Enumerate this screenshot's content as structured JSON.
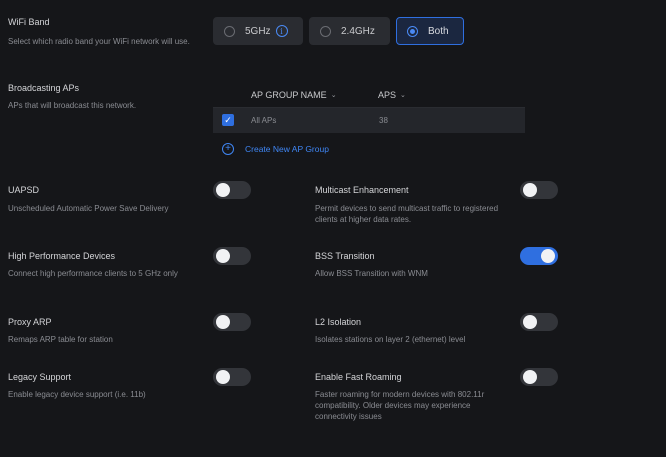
{
  "wifi_band": {
    "label": "WiFi Band",
    "desc": "Select which radio band your WiFi network will use.",
    "options": [
      "5GHz",
      "2.4GHz",
      "Both"
    ],
    "selected": "Both"
  },
  "broadcasting": {
    "label": "Broadcasting APs",
    "desc": "APs that will broadcast this network.",
    "col_group": "AP GROUP NAME",
    "col_aps": "APS",
    "rows": [
      {
        "name": "All APs",
        "aps": "38"
      }
    ],
    "create_label": "Create New AP Group"
  },
  "settings": {
    "uapsd": {
      "label": "UAPSD",
      "desc": "Unscheduled Automatic Power Save Delivery",
      "on": false
    },
    "high_perf": {
      "label": "High Performance Devices",
      "desc": "Connect high performance clients to 5 GHz only",
      "on": false
    },
    "proxy_arp": {
      "label": "Proxy ARP",
      "desc": "Remaps ARP table for station",
      "on": false
    },
    "legacy": {
      "label": "Legacy Support",
      "desc": "Enable legacy device support (i.e. 11b)",
      "on": false
    },
    "multicast": {
      "label": "Multicast Enhancement",
      "desc": "Permit devices to send multicast traffic to registered clients at higher data rates.",
      "on": false
    },
    "bss": {
      "label": "BSS Transition",
      "desc": "Allow BSS Transition with WNM",
      "on": true
    },
    "l2": {
      "label": "L2 Isolation",
      "desc": "Isolates stations on layer 2 (ethernet) level",
      "on": false
    },
    "fast_roaming": {
      "label": "Enable Fast Roaming",
      "desc": "Faster roaming for modern devices with 802.11r compatibility. Older devices may experience connectivity issues",
      "on": false
    }
  },
  "colors": {
    "accent": "#2f6fe0",
    "background": "#151619"
  }
}
